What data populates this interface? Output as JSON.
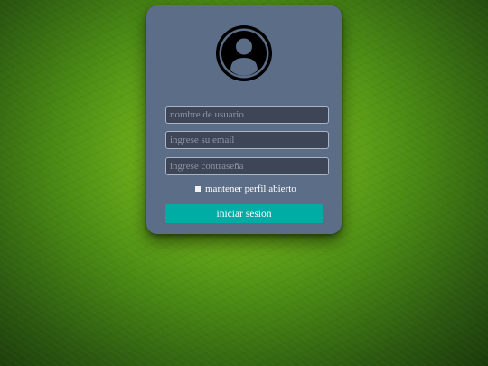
{
  "colors": {
    "card_bg": "#5c6e87",
    "field_bg": "#3d4556",
    "button_bg": "#00aca4",
    "background": "#6fb11a"
  },
  "login": {
    "avatar_icon": "user-circle-icon",
    "username_placeholder": "nombre de usuario",
    "username_value": "",
    "email_placeholder": "ingrese su email",
    "email_value": "",
    "password_placeholder": "ingrese contraseña",
    "password_value": "",
    "remember_label": "mantener perfil abierto",
    "submit_label": "iniciar sesion"
  }
}
